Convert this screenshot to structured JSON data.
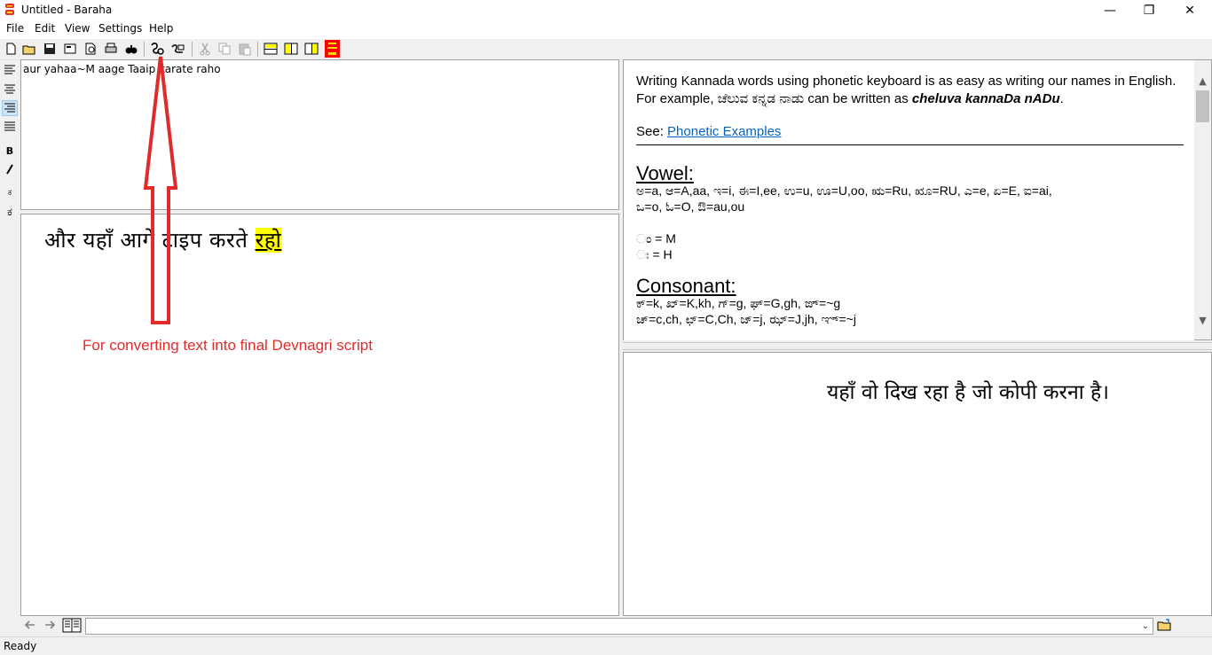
{
  "window": {
    "title": "Untitled - Baraha",
    "controls": {
      "minimize": "—",
      "maximize": "❐",
      "close": "✕"
    }
  },
  "menu": [
    "File",
    "Edit",
    "View",
    "Settings",
    "Help"
  ],
  "toolbar": {
    "icons": [
      "new-icon",
      "open-icon",
      "save-icon",
      "save-as-icon",
      "print-preview-icon",
      "print-icon",
      "find-icon",
      "convert-icon",
      "convert-all-icon",
      "cut-icon",
      "copy-icon",
      "paste-icon",
      "layout-horizontal-icon",
      "layout-vertical-icon",
      "layout-preview-icon",
      "baraha-logo-icon"
    ],
    "accent": "#ff0000"
  },
  "format_bar": {
    "bold": "B",
    "italic": "I",
    "lang1": "ಕ",
    "lang2": "ಕ"
  },
  "editor": {
    "input_text": "aur yahaa~M aage Taaip karate raho",
    "output_text_main": "और यहाँ आगे टाइप करते ",
    "output_text_highlight": "रहो"
  },
  "annotation": {
    "text": "For converting text into final Devnagri script",
    "color": "#e02b2b"
  },
  "help": {
    "intro_1": "Writing Kannada words using phonetic keyboard is as easy as writing our names in English. For example, ",
    "intro_kannada": "ಚೆಲುವ ಕನ್ನಡ ನಾಡು",
    "intro_2": " can be written as ",
    "intro_example": "cheluva kannaDa nADu",
    "intro_3": ".",
    "see_label": "See: ",
    "see_link": "Phonetic Examples",
    "vowel_heading": "Vowel:",
    "vowel_line_1": "ಅ=a, ಆ=A,aa, ಇ=i, ಈ=I,ee, ಉ=u, ಊ=U,oo, ಋ=Ru, ೠ=RU, ಎ=e, ಏ=E, ಐ=ai,",
    "vowel_line_2": "ಒ=o, ಓ=O, ಔ=au,ou",
    "anusvara": "ಂ = M",
    "visarga": "ಃ = H",
    "consonant_heading": "Consonant:",
    "consonant_line_1": "ಕ್=k, ಖ್=K,kh, ಗ್=g, ಘ್=G,gh, ಙ್=~g",
    "consonant_line_2": "ಚ್=c,ch, ಛ್=C,Ch, ಜ್=j, ಝ್=J,jh, ಞ್=~j"
  },
  "preview": {
    "text": "यहाँ वो दिख रहा है जो कोपी करना है।"
  },
  "status": {
    "text": "Ready"
  }
}
